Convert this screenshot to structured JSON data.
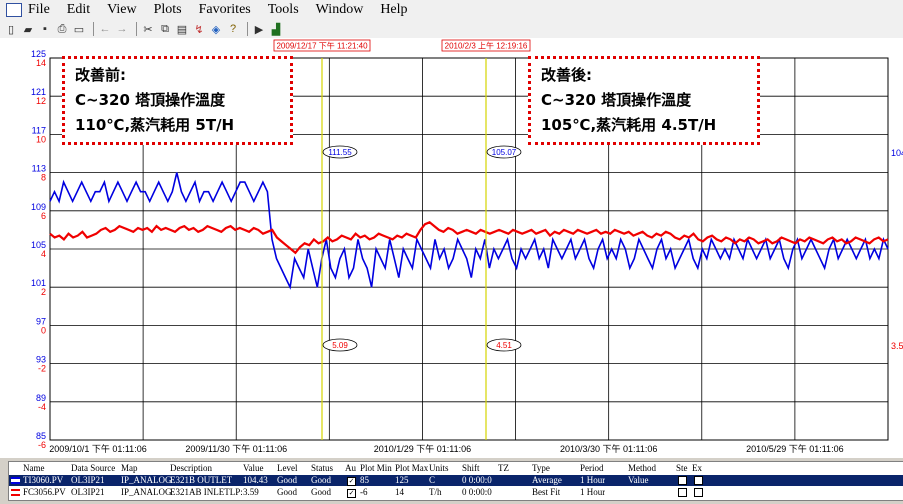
{
  "menu": [
    "File",
    "Edit",
    "View",
    "Plots",
    "Favorites",
    "Tools",
    "Window",
    "Help"
  ],
  "toolbar_icons": [
    "new-icon",
    "open-icon",
    "save-icon",
    "print-icon",
    "print-preview-icon",
    "back-icon",
    "forward-icon",
    "cut-icon",
    "copy-icon",
    "paste-icon",
    "trend-icon",
    "tag-icon",
    "help-icon",
    "play-icon",
    "chart-icon"
  ],
  "cursors": {
    "left_time": "2009/12/17 下午 11:21:40",
    "right_time": "2010/2/3 上午 12:19:16",
    "left_blue": "111.55",
    "left_red": "5.09",
    "right_blue": "105.07",
    "right_red": "4.51"
  },
  "y_ticks": [
    {
      "blue": "125",
      "red": "14"
    },
    {
      "blue": "121",
      "red": "12"
    },
    {
      "blue": "117",
      "red": "10"
    },
    {
      "blue": "113",
      "red": "8"
    },
    {
      "blue": "109",
      "red": "6"
    },
    {
      "blue": "105",
      "red": "4"
    },
    {
      "blue": "101",
      "red": "2"
    },
    {
      "blue": "97",
      "red": "0"
    },
    {
      "blue": "93",
      "red": "-2"
    },
    {
      "blue": "89",
      "red": "-4"
    },
    {
      "blue": "85",
      "red": "-6"
    }
  ],
  "right_labels": {
    "top": "104",
    "bottom": "3.5"
  },
  "x_ticks": [
    "2009/10/1 下午 01:11:06",
    "2009/11/30 下午 01:11:06",
    "2010/1/29 下午 01:11:06",
    "2010/3/30 下午 01:11:06",
    "2010/5/29 下午 01:11:06"
  ],
  "annotation_before": {
    "line1": "改善前:",
    "line2": "C~320 塔頂操作溫度",
    "line3": "110℃,蒸汽耗用 5T/H"
  },
  "annotation_after": {
    "line1": "改善後:",
    "line2": "C~320 塔頂操作溫度",
    "line3": "105℃,蒸汽耗用 4.5T/H"
  },
  "colors": {
    "blue": "#0000e0",
    "red": "#f00000",
    "cursor": "#d4d400",
    "grid": "#000000"
  },
  "legend": {
    "headers": [
      "Name",
      "Data Source",
      "Map",
      "Description",
      "Value",
      "Level",
      "Status",
      "Au",
      "Plot Min",
      "Plot Max",
      "Units",
      "Shift",
      "TZ",
      "Type",
      "Period",
      "Method",
      "Ste",
      "Ex"
    ],
    "rows": [
      {
        "name": "TI3060.PV",
        "source": "OL3IP21",
        "map": "IP_ANALOG",
        "desc": "E321B OUTLET",
        "value": "104.43",
        "level": "Good",
        "status": "Good",
        "plot_min": "85",
        "plot_max": "125",
        "units": "C",
        "shift": "0 0:00:0",
        "tz": "",
        "type": "Average",
        "period": "1 Hour",
        "method": "Value",
        "color": "#0000e0"
      },
      {
        "name": "FC3056.PV",
        "source": "OL3IP21",
        "map": "IP_ANALOG",
        "desc": "E321AB INLETLP:",
        "value": "3.59",
        "level": "Good",
        "status": "Good",
        "plot_min": "-6",
        "plot_max": "14",
        "units": "T/h",
        "shift": "0 0:00:0",
        "tz": "",
        "type": "Best Fit",
        "period": "1 Hour",
        "method": "",
        "color": "#f00000"
      }
    ]
  },
  "chart_data": {
    "type": "line",
    "x_range": [
      "2009-10-01",
      "2010-06-05"
    ],
    "series": [
      {
        "name": "TI3060.PV",
        "axis": "left",
        "ylim": [
          85,
          125
        ],
        "color": "#0000e0",
        "values": [
          110,
          111,
          110,
          112,
          111,
          110,
          111,
          112,
          111,
          110,
          111,
          111,
          112,
          110,
          111,
          112,
          111,
          110,
          111,
          112,
          111,
          111,
          110,
          111,
          112,
          111,
          110,
          111,
          113,
          111,
          110,
          111,
          112,
          110,
          111,
          111,
          110,
          111,
          112,
          111,
          110,
          111,
          112,
          112,
          111,
          110,
          111,
          112,
          111,
          106,
          104,
          103,
          102,
          101,
          104,
          103,
          102,
          105,
          103,
          101,
          104,
          106,
          103,
          102,
          104,
          105,
          102,
          103,
          106,
          104,
          103,
          101,
          105,
          104,
          103,
          106,
          104,
          102,
          105,
          104,
          103,
          106,
          105,
          104,
          103,
          106,
          104,
          105,
          103,
          104,
          106,
          105,
          104,
          102,
          105,
          104,
          106,
          103,
          105,
          104,
          105,
          106,
          104,
          103,
          105,
          104,
          105,
          106,
          104,
          105,
          103,
          106,
          105,
          104,
          105,
          106,
          104,
          105,
          106,
          104,
          103,
          105,
          106,
          104,
          105,
          104,
          106,
          105,
          103,
          104,
          106,
          105,
          104,
          103,
          105,
          106,
          104,
          105,
          103,
          104,
          105,
          106,
          104,
          103,
          105,
          104,
          106,
          105,
          104,
          105,
          104,
          106,
          105,
          104,
          106,
          105,
          104,
          105,
          106,
          104,
          105,
          106,
          104,
          103,
          105,
          106,
          104,
          105,
          106,
          105,
          104,
          103,
          105,
          106,
          104,
          105,
          106,
          105,
          104,
          105,
          106,
          104,
          105,
          104,
          106,
          105
        ]
      },
      {
        "name": "FC3056.PV",
        "axis": "right",
        "ylim": [
          -6,
          14
        ],
        "color": "#f00000",
        "values": [
          4.8,
          4.6,
          4.7,
          4.5,
          4.8,
          4.6,
          4.7,
          4.9,
          4.6,
          4.7,
          4.8,
          5.0,
          5.1,
          4.9,
          5.0,
          5.2,
          5.1,
          5.0,
          4.9,
          5.1,
          5.0,
          5.1,
          4.9,
          5.2,
          5.0,
          5.1,
          5.0,
          4.9,
          5.1,
          5.2,
          5.0,
          5.1,
          4.9,
          5.0,
          5.2,
          5.1,
          5.0,
          4.9,
          5.1,
          5.2,
          5.0,
          5.1,
          5.0,
          4.9,
          5.1,
          5.0,
          4.8,
          4.9,
          5.0,
          4.6,
          4.4,
          4.2,
          4.0,
          3.8,
          4.1,
          4.3,
          4.2,
          4.5,
          4.3,
          4.4,
          4.6,
          4.4,
          4.5,
          4.7,
          4.6,
          4.5,
          4.8,
          4.6,
          4.7,
          4.5,
          4.6,
          4.8,
          4.7,
          4.6,
          4.5,
          4.7,
          4.6,
          4.8,
          4.7,
          4.6,
          5.0,
          5.3,
          5.4,
          5.2,
          5.0,
          4.9,
          5.1,
          5.0,
          4.8,
          4.9,
          5.0,
          4.9,
          4.8,
          5.0,
          4.9,
          4.8,
          4.9,
          5.0,
          4.9,
          4.8,
          5.0,
          4.9,
          4.8,
          4.9,
          5.0,
          4.8,
          4.9,
          5.0,
          4.7,
          4.9,
          4.8,
          5.0,
          4.9,
          4.8,
          5.0,
          4.9,
          4.8,
          4.9,
          5.0,
          4.8,
          4.9,
          4.8,
          5.0,
          4.9,
          4.8,
          4.9,
          4.7,
          4.8,
          4.9,
          4.7,
          4.6,
          4.8,
          4.7,
          4.9,
          4.8,
          4.6,
          4.5,
          4.7,
          4.6,
          4.8,
          4.5,
          4.4,
          4.6,
          4.7,
          4.5,
          4.4,
          4.6,
          4.5,
          4.3,
          4.5,
          4.4,
          4.6,
          4.5,
          4.3,
          4.4,
          4.5,
          4.3,
          4.4,
          4.6,
          4.5,
          4.4,
          4.3,
          4.5,
          4.4,
          4.6,
          4.5,
          4.4,
          4.3,
          4.5,
          4.6,
          4.4,
          4.5,
          4.3,
          4.4,
          4.6,
          4.5,
          4.4,
          4.3,
          4.5,
          4.6,
          4.4,
          4.5
        ]
      }
    ]
  }
}
